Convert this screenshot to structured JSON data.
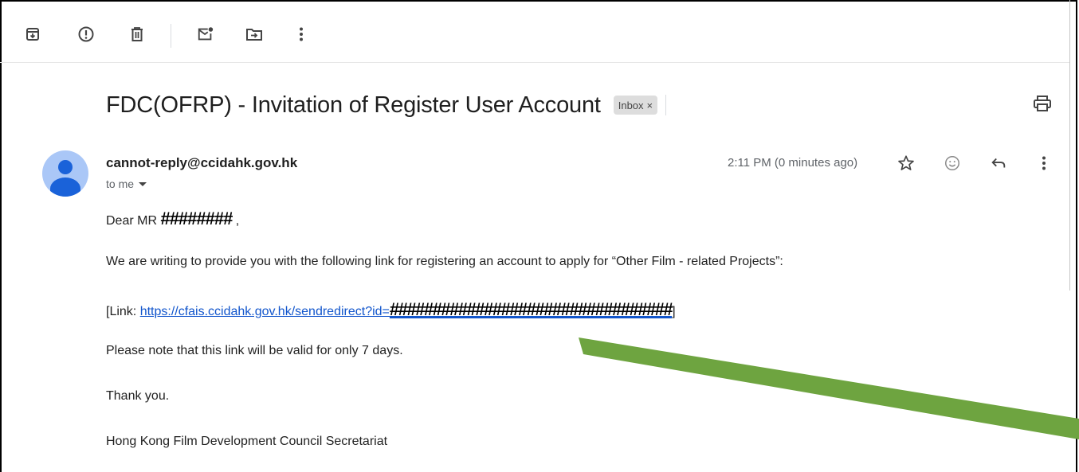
{
  "toolbar": {
    "icons": [
      "archive-icon",
      "report-spam-icon",
      "delete-icon",
      "mark-unread-icon",
      "move-to-icon",
      "more-vert-icon"
    ]
  },
  "email": {
    "subject": "FDC(OFRP) - Invitation of Register User Account",
    "label": "Inbox",
    "label_close": "×",
    "sender": "cannot-reply@ccidahk.gov.hk",
    "recipient_line": "to me",
    "timestamp": "2:11 PM (0 minutes ago)",
    "body": {
      "greeting_prefix": "Dear MR ",
      "greeting_redacted": "########",
      "greeting_suffix": " ,",
      "paragraph1": "We are writing to provide you with the following link for registering an account to apply for “Other Film - related Projects”:",
      "link_prefix": "[Link: ",
      "link_url": "https://cfais.ccidahk.gov.hk/sendredirect?id=",
      "link_redacted": "#################################",
      "link_suffix": "]",
      "paragraph2": "Please note that this link will be valid for only 7 days.",
      "closing": "Thank you.",
      "signature": "Hong Kong Film Development Council Secretariat"
    }
  },
  "colors": {
    "link": "#1155cc",
    "avatar_bg": "#aac7f7",
    "avatar_fg": "#1a62d9",
    "annotation_stroke": "#6ea440"
  }
}
